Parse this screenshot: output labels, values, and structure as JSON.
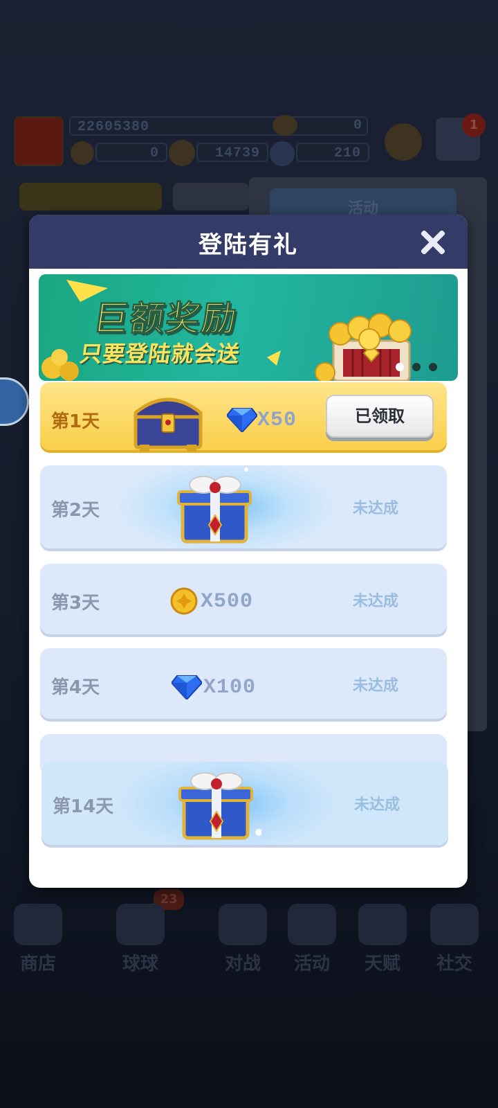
{
  "background": {
    "player_id": "22605380",
    "currency": [
      {
        "icon": "trophy-icon",
        "value": "0"
      },
      {
        "icon": "token-icon",
        "value": "0"
      },
      {
        "icon": "gold-coin-icon",
        "value": "14739"
      },
      {
        "icon": "gem-icon",
        "value": "210"
      }
    ],
    "notification_badge": "1",
    "panel_title": "活动",
    "nav_badge": "23",
    "nav": [
      "商店",
      "球球",
      "对战",
      "活动",
      "天赋",
      "社交"
    ]
  },
  "modal": {
    "title": "登陆有礼",
    "banner": {
      "line1": "巨额奖励",
      "line2": "只要登陆就会送"
    },
    "days": [
      {
        "label": "第1天",
        "reward_icon": "treasure-chest-icon",
        "amount_icon": "diamond-icon",
        "amount": "X50",
        "status": "已领取",
        "claimed": true
      },
      {
        "label": "第2天",
        "reward_icon": "gift-box-icon",
        "amount": "",
        "status": "未达成",
        "claimed": false
      },
      {
        "label": "第3天",
        "amount_icon": "gold-coin-icon",
        "amount": "X500",
        "status": "未达成",
        "claimed": false
      },
      {
        "label": "第4天",
        "amount_icon": "diamond-icon",
        "amount": "X100",
        "status": "未达成",
        "claimed": false
      },
      {
        "label": "第14天",
        "reward_icon": "gift-box-icon",
        "amount": "",
        "status": "未达成",
        "claimed": false
      }
    ]
  },
  "colors": {
    "header": "#343b66",
    "claimed_card": "#f9cf4a",
    "pending_card": "#dde8fb",
    "pending_text": "#99bedf"
  }
}
